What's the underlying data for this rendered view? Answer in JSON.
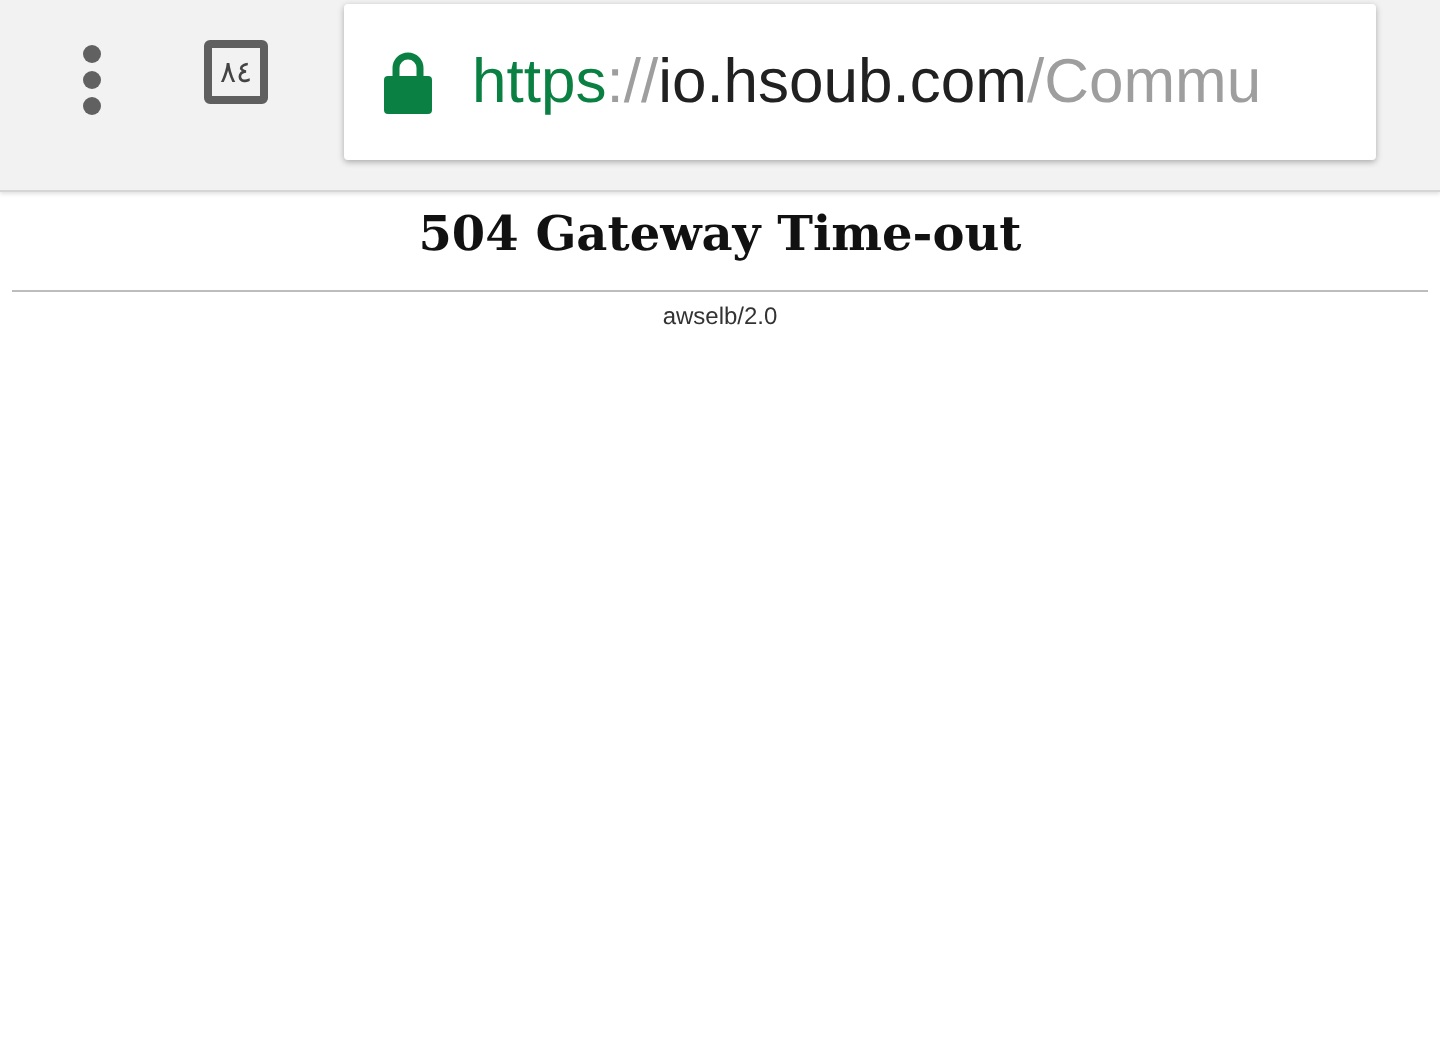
{
  "toolbar": {
    "tab_count": "٨٤",
    "address_bar": {
      "scheme": "https",
      "separator": "://",
      "host": "io.hsoub.com",
      "path": "/Commu",
      "secure": true
    }
  },
  "page": {
    "heading": "504 Gateway Time-out",
    "server": "awselb/2.0"
  }
}
